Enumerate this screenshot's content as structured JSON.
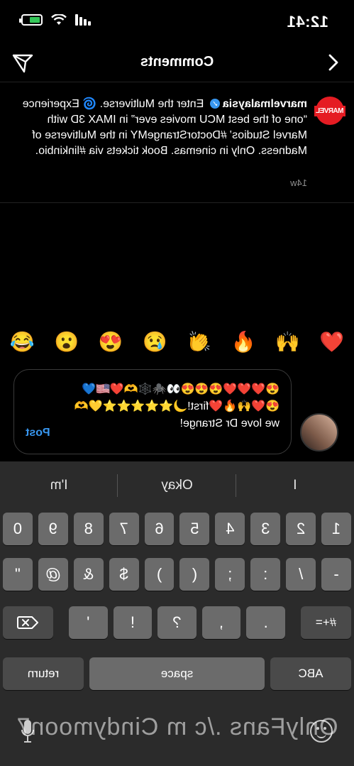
{
  "status_bar": {
    "time": "12:41"
  },
  "header": {
    "title": "Comments"
  },
  "caption": {
    "username": "marvelmalaysia",
    "avatar_label": "MARVEL",
    "text": " Enter the Multiverse. 🌀 Experience “one of the best MCU movies ever” in IMAX 3D with Marvel Studios’ #DoctorStrangeMY in the Multiverse of Madness. Only in cinemas. Book tickets via #linkinbio.",
    "time": "14w"
  },
  "quick_emojis": [
    "❤️",
    "🙌",
    "🔥",
    "👏",
    "😢",
    "😍",
    "😮",
    "😂"
  ],
  "composer": {
    "text": "😍❤️❤️❤️😍😍😍👀🕷️🕸️🫶❤️🇺🇸💙😍❤️🙌🔥❤️first!🌙⭐⭐⭐⭐⭐💛🫶 we love Dr Strange!",
    "post_label": "Post"
  },
  "keyboard": {
    "suggestions": [
      "I",
      "Okay",
      "I'm"
    ],
    "row1": [
      "1",
      "2",
      "3",
      "4",
      "5",
      "6",
      "7",
      "8",
      "9",
      "0"
    ],
    "row2": [
      "-",
      "/",
      ":",
      ";",
      "(",
      ")",
      "$",
      "&",
      "@",
      "\""
    ],
    "row3": [
      "#+=",
      ".",
      ",",
      "?",
      "!",
      "'"
    ],
    "row4": [
      "ABC",
      "space",
      "return"
    ]
  },
  "watermark": "OnlyFans ./c m Cindymoon7"
}
